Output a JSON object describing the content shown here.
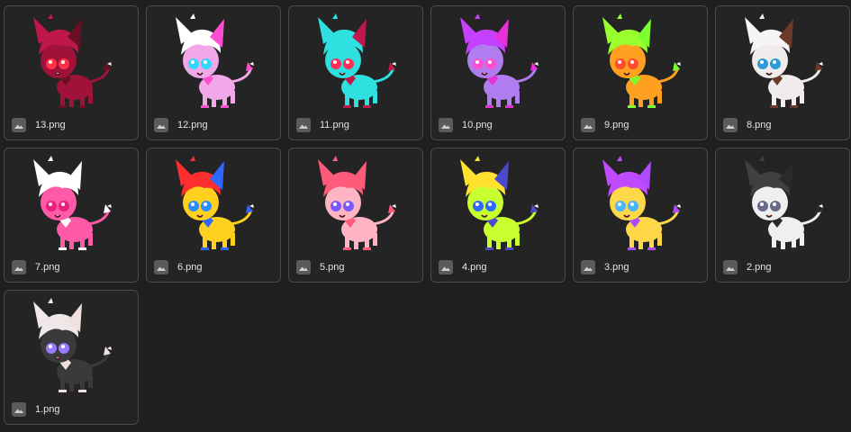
{
  "files": [
    {
      "name": "13.png",
      "body": "#a0123a",
      "accent": "#6b0f24",
      "hair": "#c0174a",
      "eye": "#ff3344",
      "icon": "image-file-icon"
    },
    {
      "name": "12.png",
      "body": "#f0a8e8",
      "accent": "#ff4fd0",
      "hair": "#ffffff",
      "eye": "#33d6ff",
      "icon": "image-file-icon"
    },
    {
      "name": "11.png",
      "body": "#2ee0e0",
      "accent": "#c0174a",
      "hair": "#2ee0e0",
      "eye": "#ff2d55",
      "icon": "image-file-icon"
    },
    {
      "name": "10.png",
      "body": "#b07cf0",
      "accent": "#e830d8",
      "hair": "#c640ff",
      "eye": "#ff4fd0",
      "icon": "image-file-icon"
    },
    {
      "name": "9.png",
      "body": "#ffa020",
      "accent": "#7bff2e",
      "hair": "#9aff2e",
      "eye": "#ff4a2e",
      "icon": "image-file-icon"
    },
    {
      "name": "8.png",
      "body": "#f0ecec",
      "accent": "#6b3a2a",
      "hair": "#f5f5f5",
      "eye": "#2e9ad6",
      "icon": "image-file-icon"
    },
    {
      "name": "7.png",
      "body": "#ff5aa8",
      "accent": "#ffffff",
      "hair": "#ffffff",
      "eye": "#e8207c",
      "icon": "image-file-icon"
    },
    {
      "name": "6.png",
      "body": "#ffd11e",
      "accent": "#2e66ff",
      "hair": "#ff2e2e",
      "eye": "#2e8cff",
      "icon": "image-file-icon"
    },
    {
      "name": "5.png",
      "body": "#ffb4c4",
      "accent": "#ff5a7a",
      "hair": "#ff5a7a",
      "eye": "#7a5aff",
      "icon": "image-file-icon"
    },
    {
      "name": "4.png",
      "body": "#c8ff2e",
      "accent": "#4a4acc",
      "hair": "#ffe12e",
      "eye": "#2e6aff",
      "icon": "image-file-icon"
    },
    {
      "name": "3.png",
      "body": "#ffd84a",
      "accent": "#b04aff",
      "hair": "#c04aff",
      "eye": "#4ab4ff",
      "icon": "image-file-icon"
    },
    {
      "name": "2.png",
      "body": "#efefef",
      "accent": "#2a2a2a",
      "hair": "#404040",
      "eye": "#6a6a8a",
      "icon": "image-file-icon"
    },
    {
      "name": "1.png",
      "body": "#3a3a3a",
      "accent": "#f0e0e0",
      "hair": "#f0e8e8",
      "eye": "#9a7aff",
      "icon": "image-file-icon"
    }
  ]
}
